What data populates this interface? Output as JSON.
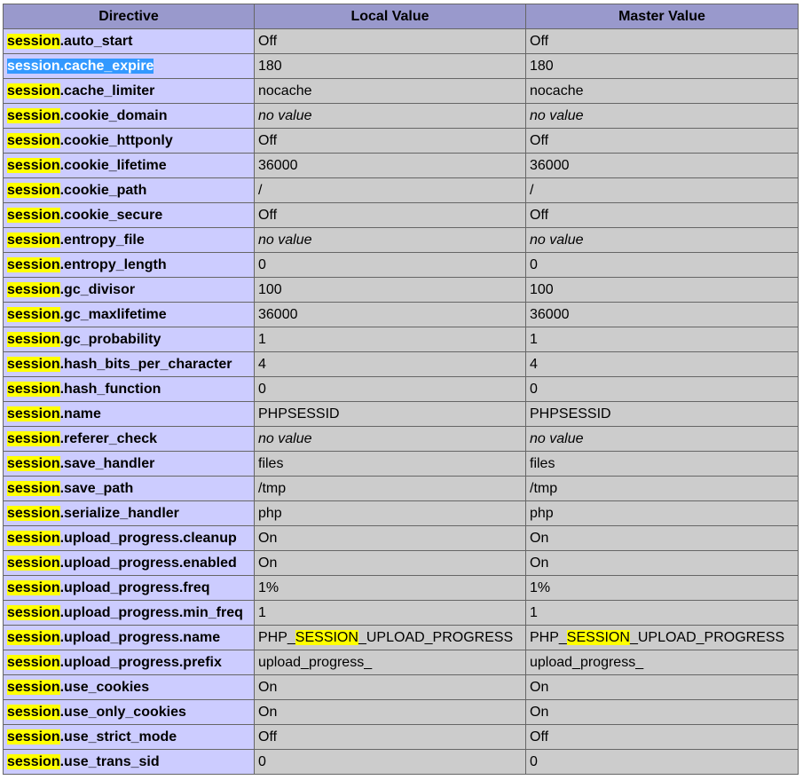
{
  "highlight_color": "#ffff00",
  "selection_color": "#3399ff",
  "header_color": "#9999cc",
  "directive_cell_color": "#ccccff",
  "value_cell_color": "#cccccc",
  "headers": {
    "directive": "Directive",
    "local": "Local Value",
    "master": "Master Value"
  },
  "highlight_term": "session",
  "rows": [
    {
      "prefix": "session",
      "suffix": ".auto_start",
      "local": "Off",
      "master": "Off"
    },
    {
      "prefix": "session",
      "suffix": ".cache_expire",
      "local": "180",
      "master": "180",
      "selected": true
    },
    {
      "prefix": "session",
      "suffix": ".cache_limiter",
      "local": "nocache",
      "master": "nocache"
    },
    {
      "prefix": "session",
      "suffix": ".cookie_domain",
      "local": "no value",
      "master": "no value",
      "no_value": true
    },
    {
      "prefix": "session",
      "suffix": ".cookie_httponly",
      "local": "Off",
      "master": "Off"
    },
    {
      "prefix": "session",
      "suffix": ".cookie_lifetime",
      "local": "36000",
      "master": "36000"
    },
    {
      "prefix": "session",
      "suffix": ".cookie_path",
      "local": "/",
      "master": "/"
    },
    {
      "prefix": "session",
      "suffix": ".cookie_secure",
      "local": "Off",
      "master": "Off"
    },
    {
      "prefix": "session",
      "suffix": ".entropy_file",
      "local": "no value",
      "master": "no value",
      "no_value": true
    },
    {
      "prefix": "session",
      "suffix": ".entropy_length",
      "local": "0",
      "master": "0"
    },
    {
      "prefix": "session",
      "suffix": ".gc_divisor",
      "local": "100",
      "master": "100"
    },
    {
      "prefix": "session",
      "suffix": ".gc_maxlifetime",
      "local": "36000",
      "master": "36000"
    },
    {
      "prefix": "session",
      "suffix": ".gc_probability",
      "local": "1",
      "master": "1"
    },
    {
      "prefix": "session",
      "suffix": ".hash_bits_per_character",
      "local": "4",
      "master": "4"
    },
    {
      "prefix": "session",
      "suffix": ".hash_function",
      "local": "0",
      "master": "0"
    },
    {
      "prefix": "session",
      "suffix": ".name",
      "local": "PHPSESSID",
      "master": "PHPSESSID"
    },
    {
      "prefix": "session",
      "suffix": ".referer_check",
      "local": "no value",
      "master": "no value",
      "no_value": true
    },
    {
      "prefix": "session",
      "suffix": ".save_handler",
      "local": "files",
      "master": "files"
    },
    {
      "prefix": "session",
      "suffix": ".save_path",
      "local": "/tmp",
      "master": "/tmp"
    },
    {
      "prefix": "session",
      "suffix": ".serialize_handler",
      "local": "php",
      "master": "php"
    },
    {
      "prefix": "session",
      "suffix": ".upload_progress.cleanup",
      "local": "On",
      "master": "On"
    },
    {
      "prefix": "session",
      "suffix": ".upload_progress.enabled",
      "local": "On",
      "master": "On"
    },
    {
      "prefix": "session",
      "suffix": ".upload_progress.freq",
      "local": "1%",
      "master": "1%"
    },
    {
      "prefix": "session",
      "suffix": ".upload_progress.min_freq",
      "local": "1",
      "master": "1"
    },
    {
      "prefix": "session",
      "suffix": ".upload_progress.name",
      "local": "PHP_SESSION_UPLOAD_PROGRESS",
      "master": "PHP_SESSION_UPLOAD_PROGRESS",
      "local_parts": [
        "PHP_",
        "SESSION",
        "_UPLOAD_PROGRESS"
      ],
      "master_parts": [
        "PHP_",
        "SESSION",
        "_UPLOAD_PROGRESS"
      ]
    },
    {
      "prefix": "session",
      "suffix": ".upload_progress.prefix",
      "local": "upload_progress_",
      "master": "upload_progress_"
    },
    {
      "prefix": "session",
      "suffix": ".use_cookies",
      "local": "On",
      "master": "On"
    },
    {
      "prefix": "session",
      "suffix": ".use_only_cookies",
      "local": "On",
      "master": "On"
    },
    {
      "prefix": "session",
      "suffix": ".use_strict_mode",
      "local": "Off",
      "master": "Off"
    },
    {
      "prefix": "session",
      "suffix": ".use_trans_sid",
      "local": "0",
      "master": "0"
    }
  ]
}
